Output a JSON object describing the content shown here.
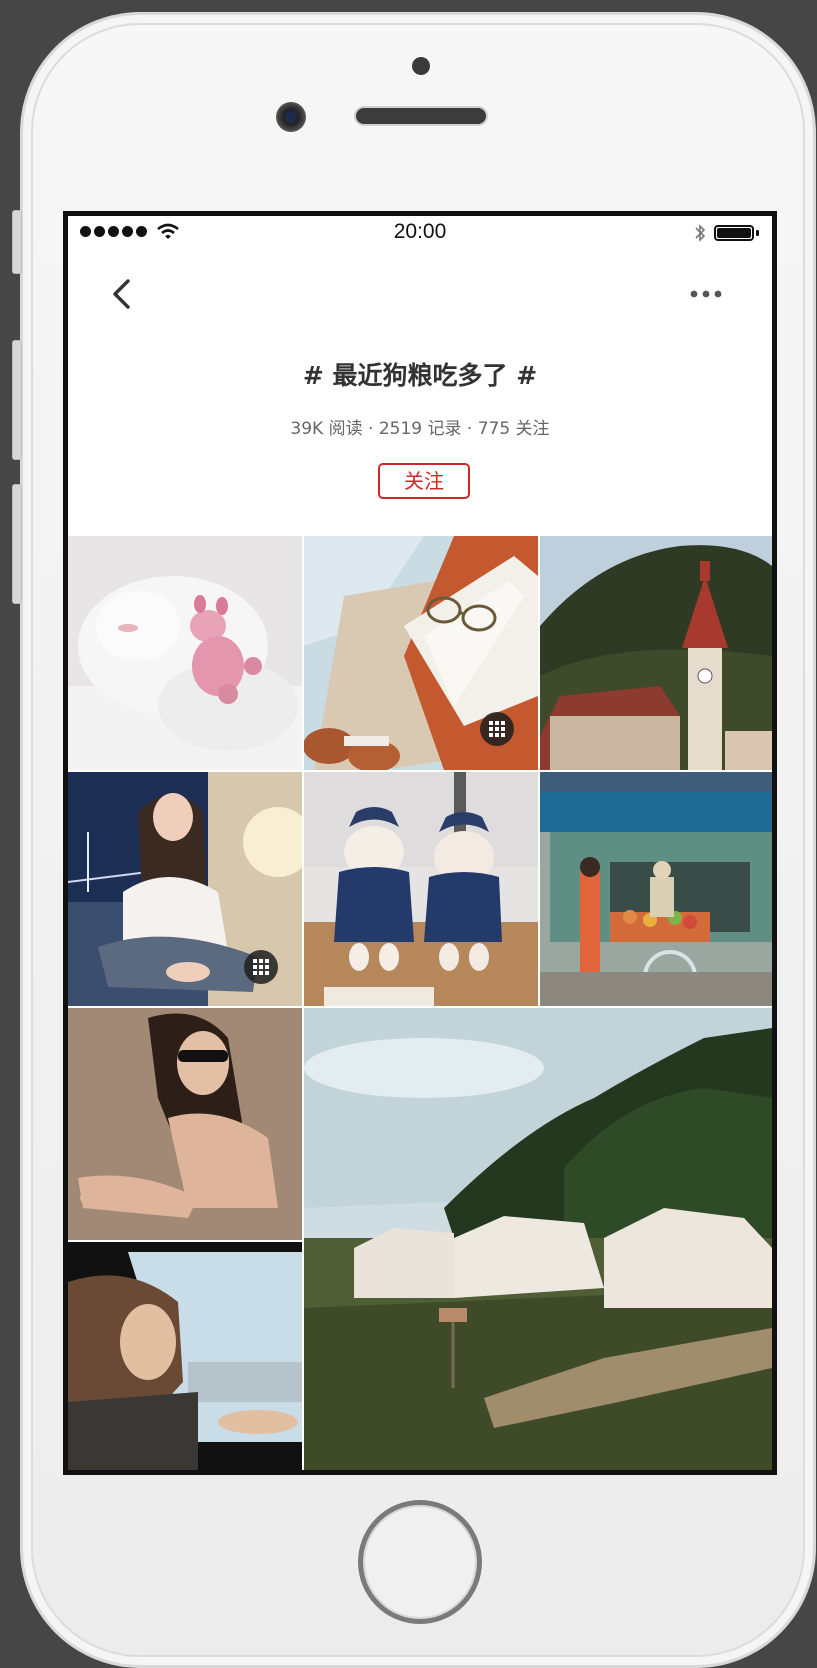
{
  "status_bar": {
    "time": "20:00",
    "signal_icon": "signal-dots-icon",
    "wifi_icon": "wifi-icon",
    "bluetooth_icon": "bluetooth-icon",
    "battery_icon": "battery-icon",
    "battery_level": 1.0
  },
  "nav": {
    "back_icon": "chevron-left-icon",
    "more_icon": "more-horizontal-icon"
  },
  "topic": {
    "title": "# 最近狗粮吃多了 #",
    "stats": "39K 阅读 · 2519 记录 · 775 关注",
    "follow_label": "关注"
  },
  "accent_color": "#d0282a",
  "photos": [
    {
      "subject": "white cat sleeping with pink toy",
      "multi_image": false
    },
    {
      "subject": "open book with sunglasses on towel",
      "multi_image": true
    },
    {
      "subject": "gothic church with clock tower",
      "multi_image": false
    },
    {
      "subject": "girl sitting near bridge at night",
      "multi_image": true
    },
    {
      "subject": "two dogs in denim outfits",
      "multi_image": false
    },
    {
      "subject": "street fruit vendor cart",
      "multi_image": false
    },
    {
      "subject": "woman with sunglasses on sand",
      "multi_image": false
    },
    {
      "subject": "camping tents in grassland",
      "multi_image": false
    },
    {
      "subject": "woman looking out car window",
      "multi_image": false
    }
  ]
}
